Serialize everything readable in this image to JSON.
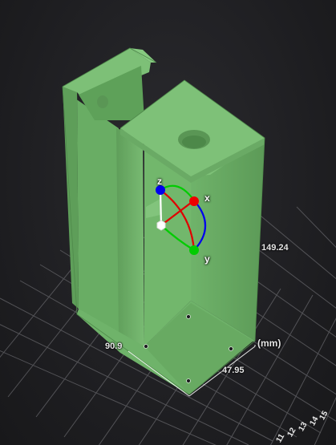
{
  "dimensions": {
    "height": "149.24",
    "width": "90.9",
    "depth": "47.95",
    "unit": "(mm)"
  },
  "gizmo": {
    "x_label": "x",
    "y_label": "y",
    "z_label": "z",
    "colors": {
      "x": "#ff0000",
      "y": "#00cc00",
      "z": "#0000ff",
      "center": "#ffffff"
    }
  },
  "ruler": {
    "ticks": [
      "11",
      "12",
      "13",
      "14",
      "15"
    ]
  },
  "colors": {
    "background": "#1c1c1f",
    "model": "#6fb36a",
    "grid": "#5a5a5e"
  }
}
